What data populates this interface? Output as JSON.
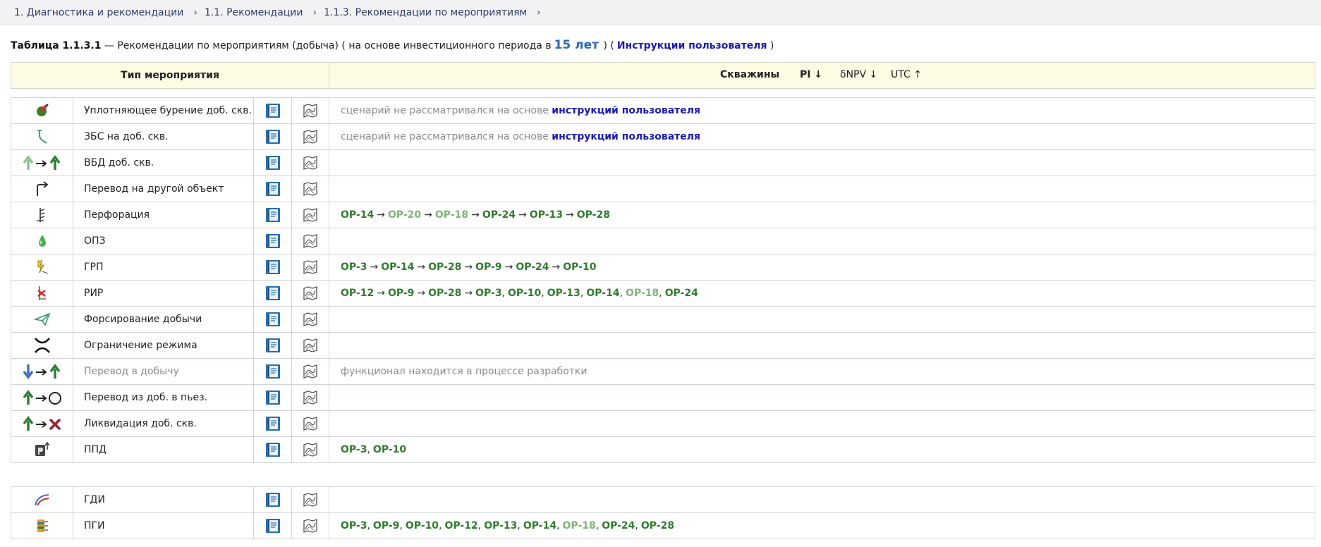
{
  "breadcrumb": [
    "1. Диагностика и рекомендации",
    "1.1. Рекомендации",
    "1.1.3. Рекомендации по мероприятиям"
  ],
  "breadcrumb_separator": "›",
  "caption": {
    "table_number": "Таблица 1.1.3.1",
    "text1": " — Рекомендации по мероприятиям (добыча) ( на основе инвестиционного периода в",
    "years": "15 лет",
    "text2": " ) (",
    "link": "Инструкции пользователя",
    "text3": " )"
  },
  "header": {
    "type_label": "Тип мероприятия",
    "wells": "Скважины",
    "pi": "PI ↓",
    "dnpv": "δNPV ↓",
    "utc": "UTC ↑"
  },
  "notes": {
    "not_considered": "сценарий не рассматривался на основе ",
    "user_instructions": "инструкций пользователя",
    "in_dev": "функционал находится в процессе разработки"
  },
  "rows": [
    {
      "name": "Уплотняющее бурение доб. скв.",
      "icon": "drill-icon"
    },
    {
      "name": "ЗБС на доб. скв.",
      "icon": "sidetrack-icon"
    },
    {
      "name": "ВБД доб. скв.",
      "icon": "arrow-up-to-up-icon"
    },
    {
      "name": "Перевод на другой объект",
      "icon": "redirect-arrow-icon"
    },
    {
      "name": "Перфорация",
      "icon": "perforation-icon"
    },
    {
      "name": "ОПЗ",
      "icon": "drop-icon"
    },
    {
      "name": "ГРП",
      "icon": "fracturing-icon"
    },
    {
      "name": "РИР",
      "icon": "repair-icon"
    },
    {
      "name": "Форсирование добычи",
      "icon": "paper-plane-icon"
    },
    {
      "name": "Ограничение режима",
      "icon": "restriction-icon"
    },
    {
      "name": "Перевод в добычу",
      "icon": "arrow-down-to-up-icon"
    },
    {
      "name": "Перевод из доб. в пьез.",
      "icon": "arrow-up-to-circle-icon"
    },
    {
      "name": "Ликвидация доб. скв.",
      "icon": "arrow-up-to-cross-icon"
    },
    {
      "name": "ППД",
      "icon": "pressure-maintenance-icon"
    },
    {
      "name": "ГДИ",
      "icon": "gdi-curve-icon"
    },
    {
      "name": "ПГИ",
      "icon": "pgi-log-icon"
    }
  ],
  "chains": {
    "perforation": [
      "OP-14",
      "OP-20",
      "OP-18",
      "OP-24",
      "OP-13",
      "OP-28"
    ],
    "grp": [
      "OP-3",
      "OP-14",
      "OP-28",
      "OP-9",
      "OP-24",
      "OP-10"
    ],
    "rir_seq": [
      "OP-12",
      "OP-9",
      "OP-28",
      "OP-3"
    ],
    "rir_list": [
      "OP-10",
      "OP-13",
      "OP-14",
      "OP-18",
      "OP-24"
    ],
    "ppd": [
      "OP-3",
      "OP-10"
    ],
    "pgi": [
      "OP-3",
      "OP-9",
      "OP-10",
      "OP-12",
      "OP-13",
      "OP-14",
      "OP-18",
      "OP-24",
      "OP-28"
    ]
  },
  "colors": {
    "op_dark": "#2f7d2c",
    "op_light": "#7fb57a",
    "book": "#2b6fa8",
    "link": "#1a1ab5"
  }
}
